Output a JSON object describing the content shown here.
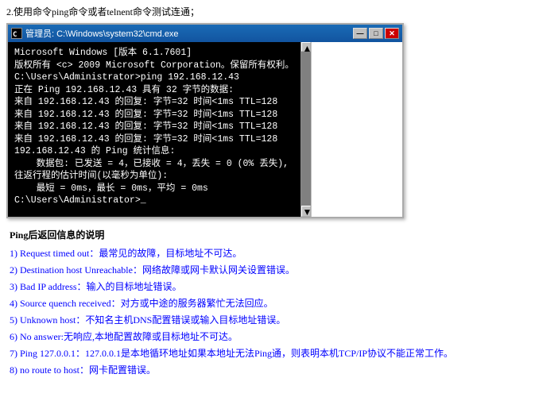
{
  "instruction": "2.使用命令ping命令或者telnent命令测试连通；",
  "cmd": {
    "titlebar": {
      "icon_label": "C:\\",
      "title": "管理员: C:\\Windows\\system32\\cmd.exe",
      "min_btn": "—",
      "max_btn": "□",
      "close_btn": "✕"
    },
    "lines": [
      {
        "text": "Microsoft Windows [版本 6.1.7601]",
        "style": "white"
      },
      {
        "text": "版权所有 <c> 2009 Microsoft Corporation。保留所有权利。",
        "style": "white"
      },
      {
        "text": "",
        "style": "white"
      },
      {
        "text": "C:\\Users\\Administrator>ping 192.168.12.43",
        "style": "white"
      },
      {
        "text": "",
        "style": "white"
      },
      {
        "text": "正在 Ping 192.168.12.43 具有 32 字节的数据:",
        "style": "white"
      },
      {
        "text": "来自 192.168.12.43 的回复: 字节=32 时间<1ms TTL=128",
        "style": "white"
      },
      {
        "text": "来自 192.168.12.43 的回复: 字节=32 时间<1ms TTL=128",
        "style": "white"
      },
      {
        "text": "来自 192.168.12.43 的回复: 字节=32 时间<1ms TTL=128",
        "style": "white"
      },
      {
        "text": "来自 192.168.12.43 的回复: 字节=32 时间<1ms TTL=128",
        "style": "white"
      },
      {
        "text": "",
        "style": "white"
      },
      {
        "text": "192.168.12.43 的 Ping 统计信息:",
        "style": "white"
      },
      {
        "text": "    数据包: 已发送 = 4，已接收 = 4，丢失 = 0 (0% 丢失),",
        "style": "white"
      },
      {
        "text": "往返行程的估计时间(以毫秒为单位):",
        "style": "white"
      },
      {
        "text": "    最短 = 0ms，最长 = 0ms，平均 = 0ms",
        "style": "white"
      },
      {
        "text": "",
        "style": "white"
      },
      {
        "text": "C:\\Users\\Administrator>_",
        "style": "white"
      }
    ]
  },
  "ping_explanation": {
    "title": "Ping后返回信息的说明",
    "items": [
      {
        "num": "1)",
        "text": "Request timed out：最常见的故障，目标地址不可达。"
      },
      {
        "num": "2)",
        "text": "Destination host Unreachable：网络故障或网卡默认网关设置错误。"
      },
      {
        "num": "3)",
        "text": "Bad IP address：输入的目标地址错误。"
      },
      {
        "num": "4)",
        "text": "Source quench received：对方或中途的服务器繁忙无法回应。"
      },
      {
        "num": "5)",
        "text": "Unknown host：不知名主机DNS配置错误或输入目标地址错误。"
      },
      {
        "num": "6)",
        "text": "No answer:无响应,本地配置故障或目标地址不可达。"
      },
      {
        "num": "7)",
        "text": "Ping 127.0.0.1：127.0.0.1是本地循环地址如果本地址无法Ping通，则表明本机TCP/IP协议不能正常工作。"
      },
      {
        "num": "8)",
        "text": "no route to host：网卡配置错误。"
      }
    ]
  }
}
